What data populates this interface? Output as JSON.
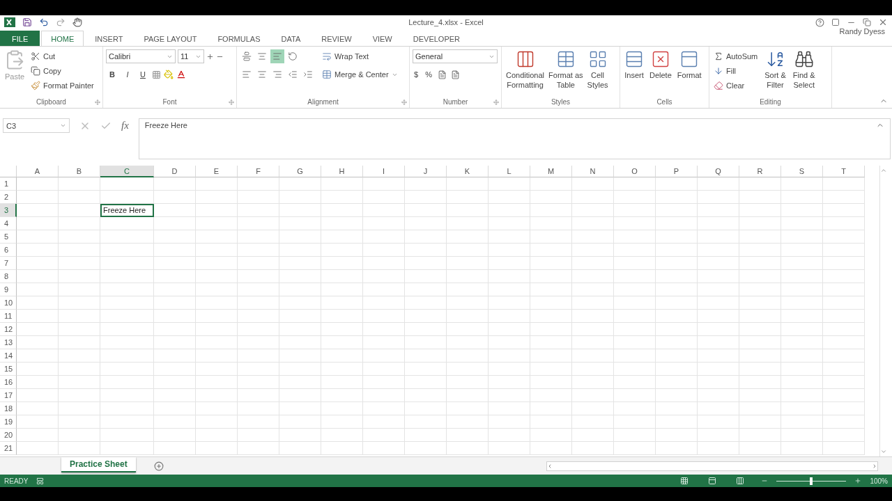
{
  "title_bar": {
    "title": "Lecture_4.xlsx - Excel",
    "user": "Randy Dyess"
  },
  "tabs": [
    {
      "label": "FILE",
      "kind": "file",
      "selected": false
    },
    {
      "label": "HOME",
      "kind": "tab",
      "selected": true
    },
    {
      "label": "INSERT",
      "kind": "tab",
      "selected": false
    },
    {
      "label": "PAGE LAYOUT",
      "kind": "tab",
      "selected": false
    },
    {
      "label": "FORMULAS",
      "kind": "tab",
      "selected": false
    },
    {
      "label": "DATA",
      "kind": "tab",
      "selected": false
    },
    {
      "label": "REVIEW",
      "kind": "tab",
      "selected": false
    },
    {
      "label": "VIEW",
      "kind": "tab",
      "selected": false
    },
    {
      "label": "DEVELOPER",
      "kind": "tab",
      "selected": false
    }
  ],
  "ribbon": {
    "clipboard": {
      "label": "Clipboard",
      "paste": "Paste",
      "cut": "Cut",
      "copy": "Copy",
      "format_painter": "Format Painter"
    },
    "font": {
      "label": "Font",
      "font_name": "Calibri",
      "font_size": "11",
      "bold": "B",
      "italic": "I",
      "underline": "U"
    },
    "alignment": {
      "label": "Alignment",
      "wrap_text": "Wrap Text",
      "merge": "Merge & Center"
    },
    "number": {
      "label": "Number",
      "format": "General",
      "currency": "$",
      "percent": "%"
    },
    "styles": {
      "label": "Styles",
      "buttons": [
        {
          "lines": [
            "Conditional",
            "Formatting"
          ]
        },
        {
          "lines": [
            "Format as",
            "Table"
          ]
        },
        {
          "lines": [
            "Cell",
            "Styles"
          ]
        }
      ]
    },
    "cells": {
      "label": "Cells",
      "buttons": [
        {
          "label": "Insert",
          "kind": "insert"
        },
        {
          "label": "Delete",
          "kind": "delete"
        },
        {
          "label": "Format",
          "kind": "format"
        }
      ]
    },
    "editing": {
      "label": "Editing",
      "autosum": "AutoSum",
      "fill": "Fill",
      "clear": "Clear",
      "sort": [
        "Sort &",
        "Filter"
      ],
      "find": [
        "Find &",
        "Select"
      ]
    }
  },
  "formula_bar": {
    "name_box": "C3",
    "function_label": "fx",
    "value": "Freeze Here"
  },
  "columns": [
    {
      "label": "A",
      "selected": false
    },
    {
      "label": "B",
      "selected": false
    },
    {
      "label": "C",
      "selected": true
    },
    {
      "label": "D",
      "selected": false
    },
    {
      "label": "E",
      "selected": false
    },
    {
      "label": "F",
      "selected": false
    },
    {
      "label": "G",
      "selected": false
    },
    {
      "label": "H",
      "selected": false
    },
    {
      "label": "I",
      "selected": false
    },
    {
      "label": "J",
      "selected": false
    },
    {
      "label": "K",
      "selected": false
    },
    {
      "label": "L",
      "selected": false
    },
    {
      "label": "M",
      "selected": false
    },
    {
      "label": "N",
      "selected": false
    },
    {
      "label": "O",
      "selected": false
    },
    {
      "label": "P",
      "selected": false
    },
    {
      "label": "Q",
      "selected": false
    },
    {
      "label": "R",
      "selected": false
    },
    {
      "label": "S",
      "selected": false
    },
    {
      "label": "T",
      "selected": false
    }
  ],
  "rows": [
    {
      "label": "1",
      "selected": false
    },
    {
      "label": "2",
      "selected": false
    },
    {
      "label": "3",
      "selected": true,
      "active_cell": {
        "value": "Freeze Here"
      }
    },
    {
      "label": "4",
      "selected": false
    },
    {
      "label": "5",
      "selected": false
    },
    {
      "label": "6",
      "selected": false
    },
    {
      "label": "7",
      "selected": false
    },
    {
      "label": "8",
      "selected": false
    },
    {
      "label": "9",
      "selected": false
    },
    {
      "label": "10",
      "selected": false
    },
    {
      "label": "11",
      "selected": false
    },
    {
      "label": "12",
      "selected": false
    },
    {
      "label": "13",
      "selected": false
    },
    {
      "label": "14",
      "selected": false
    },
    {
      "label": "15",
      "selected": false
    },
    {
      "label": "16",
      "selected": false
    },
    {
      "label": "17",
      "selected": false
    },
    {
      "label": "18",
      "selected": false
    },
    {
      "label": "19",
      "selected": false
    },
    {
      "label": "20",
      "selected": false
    },
    {
      "label": "21",
      "selected": false
    }
  ],
  "sheet_tabs": [
    {
      "label": "Practice Sheet",
      "selected": true
    }
  ],
  "status_bar": {
    "status": "READY",
    "zoom": {
      "level": 0.5,
      "reading": "100%"
    }
  }
}
